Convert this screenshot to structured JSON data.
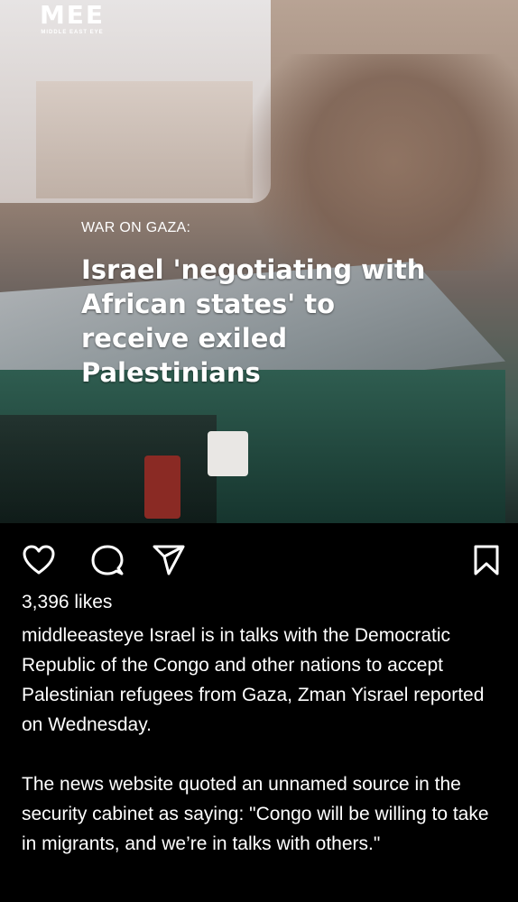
{
  "post": {
    "brand": {
      "mark": "MEE",
      "sub": "MIDDLE EAST EYE"
    },
    "kicker": "WAR ON GAZA:",
    "headline": "Israel 'negotiating with African states' to receive exiled Palestinians"
  },
  "actions": {
    "icons": [
      "heart-icon",
      "comment-icon",
      "share-icon",
      "bookmark-icon"
    ]
  },
  "likes": "3,396 likes",
  "caption": {
    "username": "middleeasteye",
    "paragraph1": "Israel is in talks with the Democratic Republic of the Congo and other nations to accept Palestinian refugees from Gaza, Zman Yisrael reported on Wednesday.",
    "paragraph2": "The news website quoted an unnamed source in the security cabinet as saying: \"Congo will be willing to take in migrants, and we’re in talks with others.\""
  }
}
